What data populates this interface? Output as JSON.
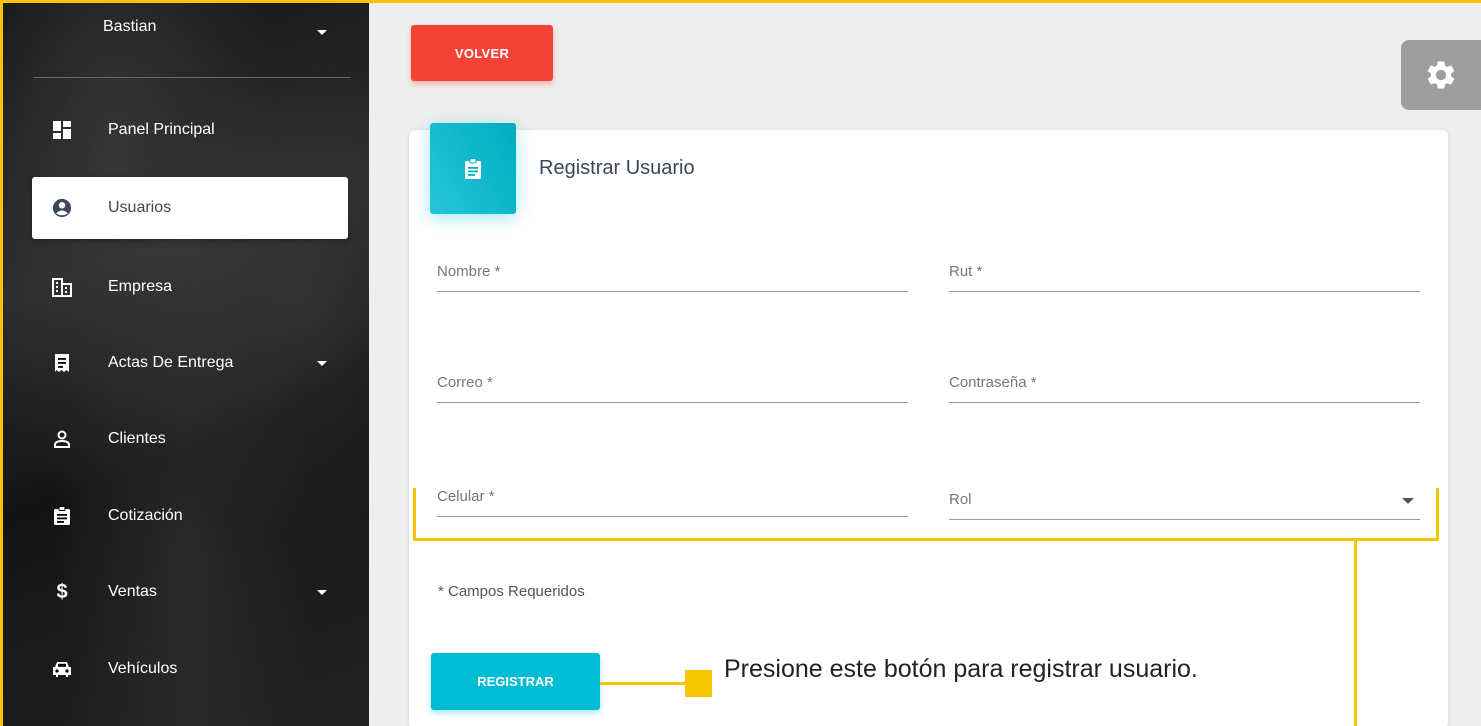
{
  "sidebar": {
    "user_name": "Bastian",
    "items": [
      {
        "label": "Panel Principal",
        "icon": "dashboard-icon",
        "active": false,
        "has_caret": false
      },
      {
        "label": "Usuarios",
        "icon": "account-circle-icon",
        "active": true,
        "has_caret": false
      },
      {
        "label": "Empresa",
        "icon": "business-icon",
        "active": false,
        "has_caret": false
      },
      {
        "label": "Actas De Entrega",
        "icon": "receipt-icon",
        "active": false,
        "has_caret": true
      },
      {
        "label": "Clientes",
        "icon": "person-outline-icon",
        "active": false,
        "has_caret": false
      },
      {
        "label": "Cotización",
        "icon": "assignment-icon",
        "active": false,
        "has_caret": false
      },
      {
        "label": "Ventas",
        "icon": "dollar-icon",
        "active": false,
        "has_caret": true
      },
      {
        "label": "Vehículos",
        "icon": "car-icon",
        "active": false,
        "has_caret": false
      }
    ]
  },
  "toolbar": {
    "back_label": "VOLVER",
    "settings_icon": "gear-icon"
  },
  "card": {
    "icon": "assignment-icon",
    "title": "Registrar Usuario",
    "fields": {
      "nombre": {
        "placeholder": "Nombre *"
      },
      "rut": {
        "placeholder": "Rut *"
      },
      "correo": {
        "placeholder": "Correo *"
      },
      "contrasena": {
        "placeholder": "Contraseña *"
      },
      "celular": {
        "placeholder": "Celular *"
      },
      "rol": {
        "placeholder": "Rol"
      }
    },
    "required_note": "* Campos Requeridos",
    "submit_label": "REGISTRAR"
  },
  "annotation": {
    "text": "Presione este botón para registrar usuario."
  },
  "colors": {
    "highlight": "#f5c500",
    "danger": "#f44336",
    "info": "#00bcd4",
    "settings": "#9e9e9e"
  }
}
